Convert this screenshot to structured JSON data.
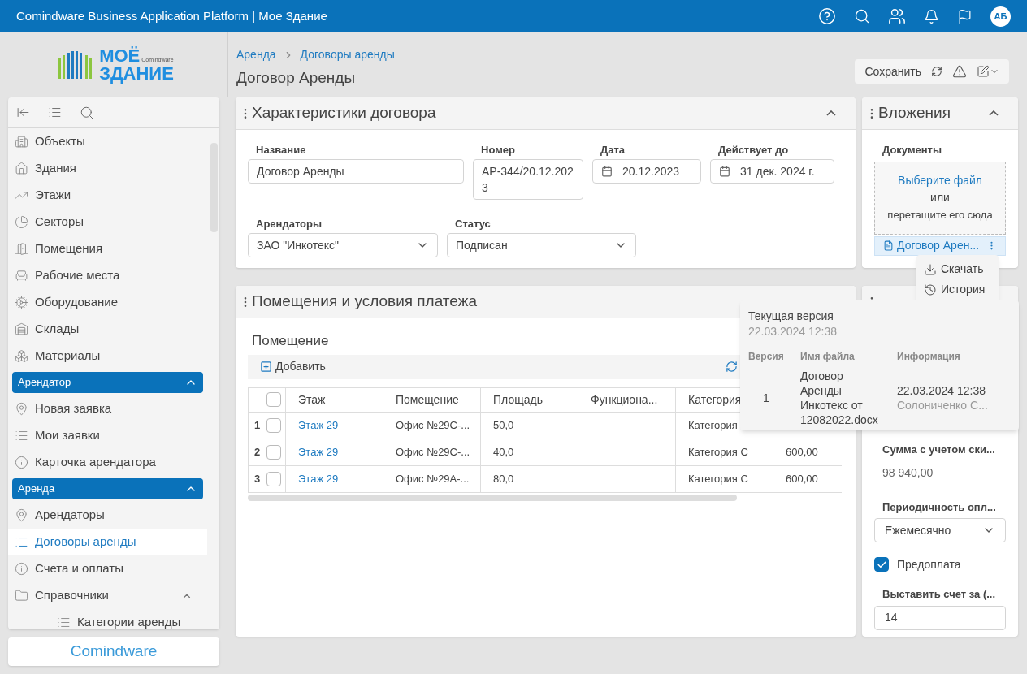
{
  "topbar": {
    "title": "Comindware Business Application Platform | Мое Здание",
    "user_initials": "АБ"
  },
  "logo": {
    "line1": "МОЁ",
    "brand": "Comindware",
    "line2": "ЗДАНИЕ"
  },
  "sidebar": {
    "items": [
      {
        "kind": "link",
        "label": "Объекты",
        "selected": false
      },
      {
        "kind": "link",
        "label": "Здания",
        "selected": false
      },
      {
        "kind": "link",
        "label": "Этажи",
        "selected": false
      },
      {
        "kind": "link",
        "label": "Секторы",
        "selected": false
      },
      {
        "kind": "link",
        "label": "Помещения",
        "selected": false
      },
      {
        "kind": "link",
        "label": "Рабочие места",
        "selected": false
      },
      {
        "kind": "link",
        "label": "Оборудование",
        "selected": false
      },
      {
        "kind": "link",
        "label": "Склады",
        "selected": false
      },
      {
        "kind": "link",
        "label": "Материалы",
        "selected": false
      },
      {
        "kind": "group",
        "label": "Арендатор",
        "expanded": true,
        "children": [
          {
            "kind": "link",
            "label": "Новая заявка",
            "selected": false
          },
          {
            "kind": "link",
            "label": "Мои заявки",
            "selected": false
          },
          {
            "kind": "link",
            "label": "Карточка арендатора",
            "selected": false
          }
        ]
      },
      {
        "kind": "group",
        "label": "Аренда",
        "expanded": true,
        "children": [
          {
            "kind": "link",
            "label": "Арендаторы",
            "selected": false
          },
          {
            "kind": "link",
            "label": "Договоры аренды",
            "selected": true
          },
          {
            "kind": "link",
            "label": "Счета и оплаты",
            "selected": false
          },
          {
            "kind": "folder",
            "label": "Справочники",
            "expanded": true,
            "children": [
              {
                "kind": "link",
                "label": "Категории аренды",
                "selected": false
              }
            ]
          }
        ]
      }
    ]
  },
  "footer_logo": "Comindware",
  "breadcrumbs": [
    "Аренда",
    "Договоры аренды"
  ],
  "page_title": "Договор Аренды",
  "toolbar": {
    "save": "Сохранить"
  },
  "contract_panel": {
    "title": "Характеристики договора",
    "expanded": true,
    "rows": [
      [
        {
          "kind": "text",
          "label": "Название",
          "value": "Договор Аренды"
        },
        {
          "kind": "text",
          "label": "Номер",
          "value": "АР-344/20.12.2023"
        },
        {
          "kind": "date",
          "label": "Дата",
          "value": "20.12.2023"
        },
        {
          "kind": "date",
          "label": "Действует до",
          "value": "31 дек. 2024 г."
        }
      ],
      [
        {
          "kind": "reference",
          "label": "Арендаторы",
          "value": "ЗАО \"Инкотекс\""
        },
        {
          "kind": "select",
          "label": "Статус",
          "value": "Подписан"
        }
      ]
    ]
  },
  "rooms_panel": {
    "title": "Помещения и условия платежа",
    "section": "Помещение",
    "add": "Добавить",
    "table": {
      "all_checked": false,
      "columns": [
        "Этаж",
        "Помещение",
        "Площадь",
        "Функциона...",
        "Категория"
      ],
      "rows": [
        {
          "number": "1",
          "checked": false,
          "floor": "Этаж 29",
          "room": "Офис №29С-...",
          "area": "50,0",
          "category": "Категория"
        },
        {
          "number": "2",
          "checked": false,
          "floor": "Этаж 29",
          "room": "Офис №29С-...",
          "area": "40,0",
          "category": "Категория C",
          "column_6": "600,00"
        },
        {
          "number": "3",
          "checked": false,
          "floor": "Этаж 29",
          "room": "Офис №29А-...",
          "area": "80,0",
          "category": "Категория C",
          "column_6": "600,00"
        }
      ]
    }
  },
  "attachments_panel": {
    "title": "Вложения",
    "expanded": true,
    "label": "Документы",
    "choose": "Выберите файл",
    "or": "или",
    "drop": "перетащите его сюда",
    "file": "Договор Арен..."
  },
  "file_menu": [
    "Скачать",
    "История"
  ],
  "sum_panel": {
    "fields": [
      {
        "kind": "readonly",
        "label": "Сумма с учетом ски...",
        "value": "98 940,00"
      },
      {
        "kind": "select",
        "label": "Периодичность опл...",
        "value": "Ежемесячно"
      },
      {
        "kind": "checkbox",
        "label": "Предоплата",
        "checked": true
      },
      {
        "kind": "number",
        "label": "Выставить счет за (...",
        "value": "14"
      }
    ]
  },
  "version_popup": {
    "title": "Текущая версия",
    "date": "22.03.2024 12:38",
    "columns": [
      "Версия",
      "Имя файла",
      "Информация"
    ],
    "rows": [
      {
        "version": "1",
        "file": "Договор Аренды Инкотекс от 12082022.docx",
        "date": "22.03.2024 12:38",
        "author": "Солониченко С..."
      }
    ]
  }
}
